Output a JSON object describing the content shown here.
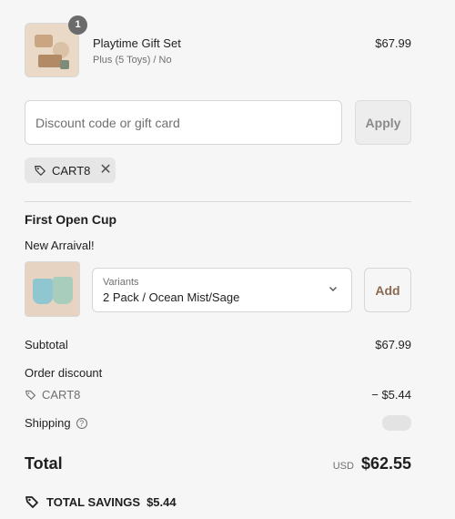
{
  "product": {
    "quantity": "1",
    "title": "Playtime Gift Set",
    "subtitle": "Plus (5 Toys) / No",
    "price": "$67.99"
  },
  "discount": {
    "placeholder": "Discount code or gift card",
    "apply_label": "Apply",
    "applied_code": "CART8"
  },
  "upsell": {
    "title": "First Open Cup",
    "subtitle": "New Arraival!",
    "variant_label": "Variants",
    "variant_value": "2 Pack / Ocean Mist/Sage",
    "add_label": "Add"
  },
  "summary": {
    "subtotal_label": "Subtotal",
    "subtotal_value": "$67.99",
    "order_discount_label": "Order discount",
    "discount_code": "CART8",
    "discount_value": "− $5.44",
    "shipping_label": "Shipping",
    "total_label": "Total",
    "currency": "USD",
    "total_value": "$62.55",
    "savings_label": "TOTAL SAVINGS",
    "savings_value": "$5.44"
  },
  "colors": {
    "background": "#f6f6f6",
    "add_text": "#8a6a52",
    "muted_text": "#707070"
  },
  "icons": [
    "tag-icon",
    "close-icon",
    "chevron-down-icon",
    "help-circle-icon"
  ]
}
